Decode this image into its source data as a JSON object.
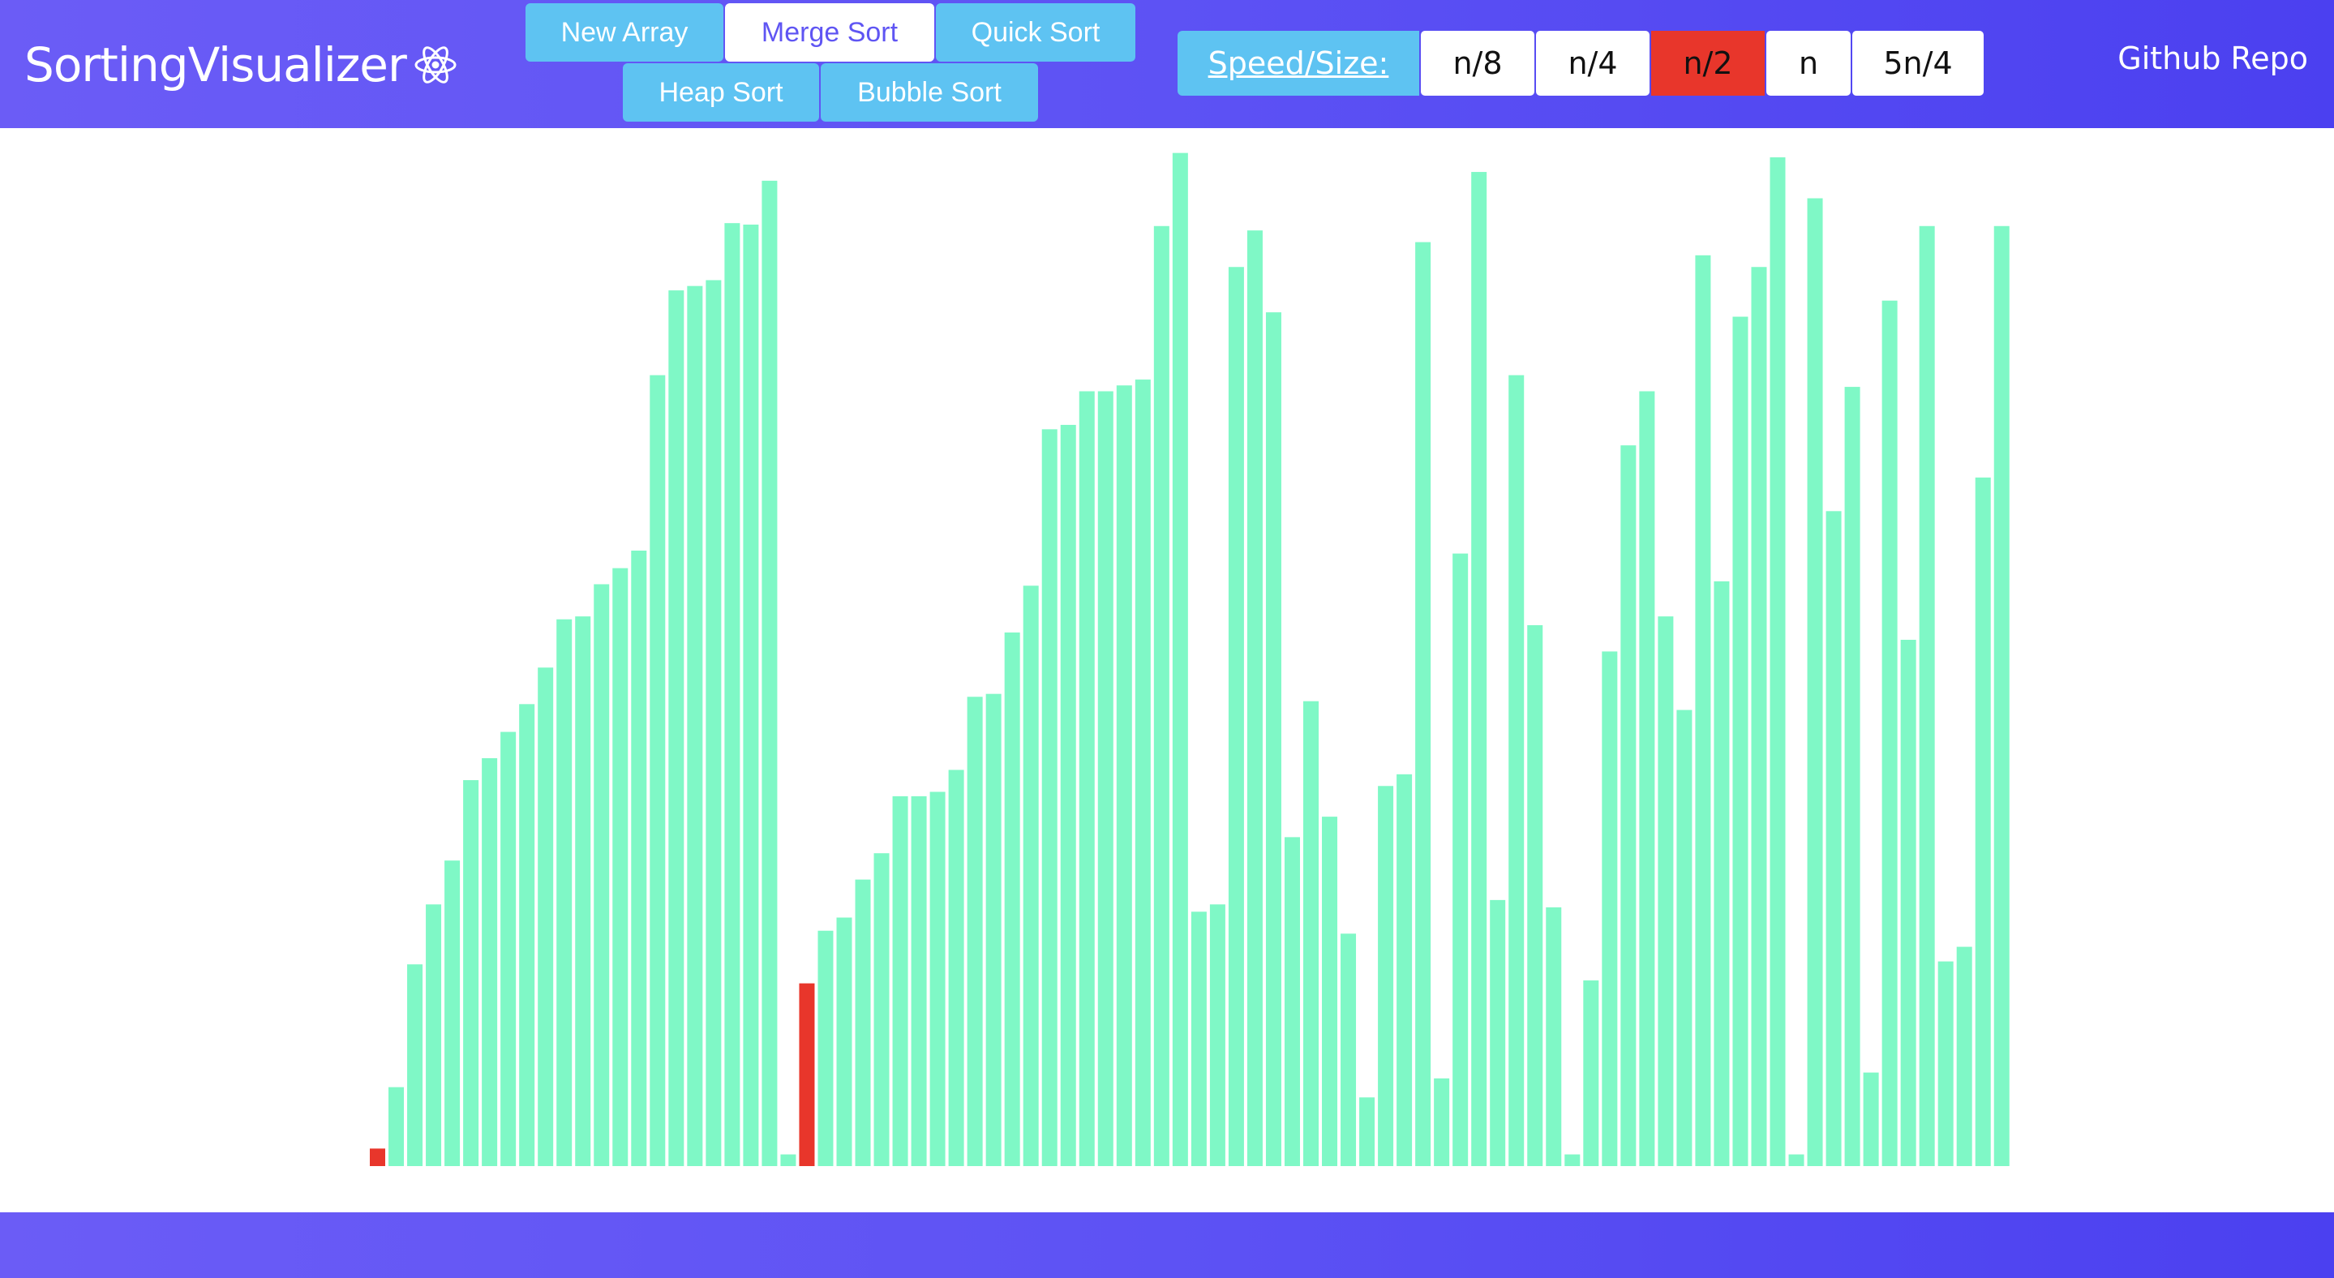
{
  "brand": {
    "title": "SortingVisualizer",
    "logo_icon": "react-atom-icon"
  },
  "algorithms": [
    {
      "label": "New Array",
      "active": false
    },
    {
      "label": "Merge Sort",
      "active": true
    },
    {
      "label": "Quick Sort",
      "active": false
    },
    {
      "label": "Heap Sort",
      "active": false
    },
    {
      "label": "Bubble Sort",
      "active": false
    }
  ],
  "speed_size": {
    "label": "Speed/Size:",
    "options": [
      "n/8",
      "n/4",
      "n/2",
      "n",
      "5n/4"
    ],
    "selected": "n/2"
  },
  "github": {
    "label": "Github Repo"
  },
  "colors": {
    "header_gradient_start": "#6b5cf6",
    "header_gradient_end": "#4b40f0",
    "button": "#5ec3f2",
    "bar": "#7ff8c6",
    "bar_highlight": "#e8362b"
  },
  "chart_data": {
    "type": "bar",
    "description_of_state": "array bars during merge sort; two bars highlighted",
    "ylim": [
      0,
      700
    ],
    "values": [
      12,
      54,
      138,
      179,
      209,
      264,
      279,
      297,
      316,
      341,
      374,
      376,
      398,
      409,
      421,
      541,
      599,
      602,
      606,
      645,
      644,
      674,
      8,
      125,
      161,
      170,
      196,
      214,
      253,
      253,
      256,
      271,
      321,
      323,
      365,
      397,
      504,
      507,
      530,
      530,
      534,
      538,
      643,
      693,
      174,
      179,
      615,
      640,
      584,
      225,
      318,
      239,
      159,
      47,
      260,
      268,
      632,
      60,
      419,
      680,
      182,
      541,
      370,
      177,
      8,
      127,
      352,
      493,
      530,
      376,
      312,
      623,
      400,
      581,
      615,
      690,
      8,
      662,
      448,
      533,
      64,
      592,
      360,
      643,
      140,
      150,
      471,
      643
    ],
    "highlighted_indices": [
      0,
      23
    ]
  }
}
